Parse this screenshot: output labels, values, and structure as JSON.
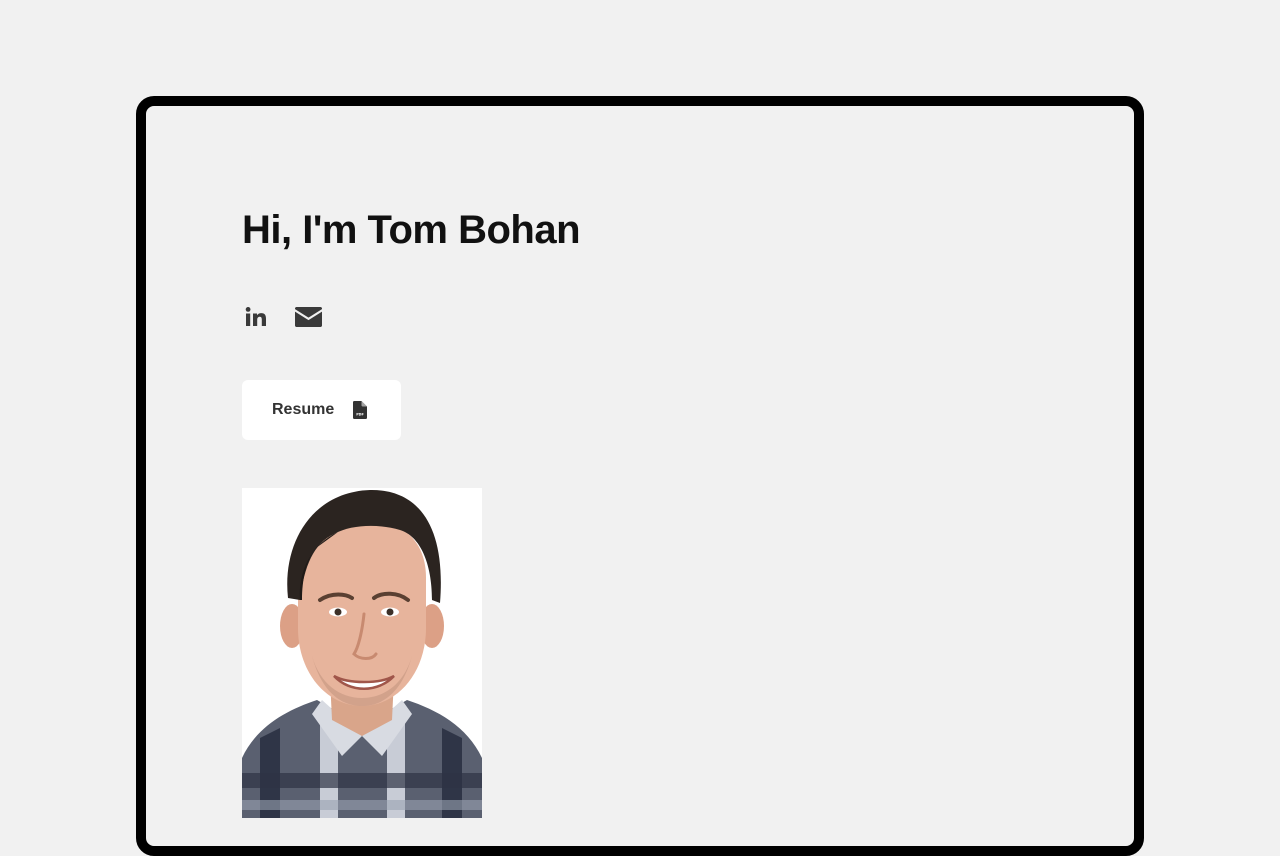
{
  "hero": {
    "title": "Hi, I'm Tom Bohan"
  },
  "social": {
    "linkedin_icon": "linkedin-icon",
    "email_icon": "envelope-icon"
  },
  "resume": {
    "label": "Resume",
    "icon": "pdf-file-icon"
  },
  "portrait": {
    "icon": "portrait-photo"
  },
  "colors": {
    "page_background": "#f1f1f1",
    "frame_border": "#000000",
    "text": "#111111",
    "icon": "#3a3a3a",
    "button_background": "#ffffff"
  }
}
